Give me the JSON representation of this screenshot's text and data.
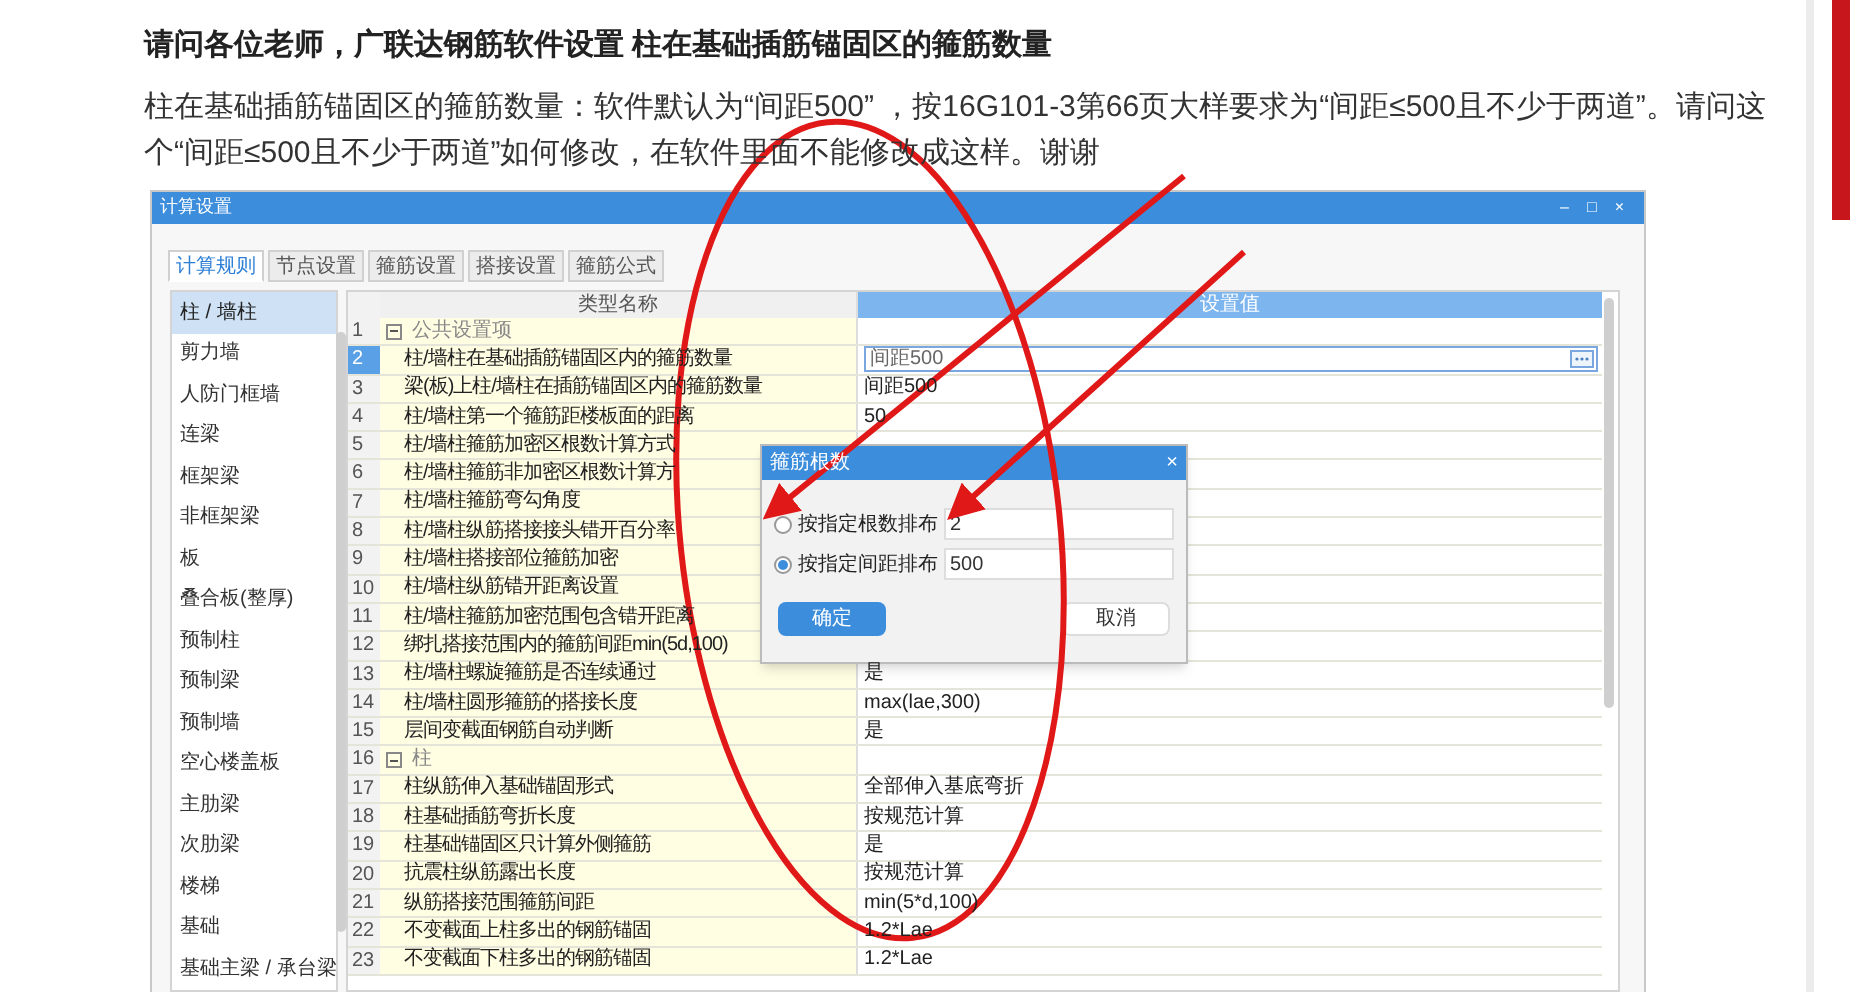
{
  "post": {
    "title": "请问各位老师，广联达钢筋软件设置 柱在基础插筋锚固区的箍筋数量",
    "body": "柱在基础插筋锚固区的箍筋数量：软件默认为“间距500” ，按16G101-3第66页大样要求为“间距≤500且不少于两道”。请问这个“间距≤500且不少于两道”如何修改，在软件里面不能修改成这样。谢谢"
  },
  "window": {
    "title": "计算设置",
    "controls": [
      "–",
      "□",
      "×"
    ]
  },
  "tabs": [
    {
      "label": "计算规则",
      "selected": true
    },
    {
      "label": "节点设置",
      "selected": false
    },
    {
      "label": "箍筋设置",
      "selected": false
    },
    {
      "label": "搭接设置",
      "selected": false
    },
    {
      "label": "箍筋公式",
      "selected": false
    }
  ],
  "sidebar": {
    "items": [
      {
        "label": "柱 / 墙柱",
        "selected": true
      },
      {
        "label": "剪力墙",
        "selected": false
      },
      {
        "label": "人防门框墙",
        "selected": false
      },
      {
        "label": "连梁",
        "selected": false
      },
      {
        "label": "框架梁",
        "selected": false
      },
      {
        "label": "非框架梁",
        "selected": false
      },
      {
        "label": "板",
        "selected": false
      },
      {
        "label": "叠合板(整厚)",
        "selected": false
      },
      {
        "label": "预制柱",
        "selected": false
      },
      {
        "label": "预制梁",
        "selected": false
      },
      {
        "label": "预制墙",
        "selected": false
      },
      {
        "label": "空心楼盖板",
        "selected": false
      },
      {
        "label": "主肋梁",
        "selected": false
      },
      {
        "label": "次肋梁",
        "selected": false
      },
      {
        "label": "楼梯",
        "selected": false
      },
      {
        "label": "基础",
        "selected": false
      },
      {
        "label": "基础主梁 / 承台梁",
        "selected": false
      }
    ]
  },
  "table": {
    "columns": [
      "类型名称",
      "设置值"
    ],
    "rows": [
      {
        "num": "1",
        "kind": "group",
        "expanded": true,
        "name": "公共设置项",
        "selected": false
      },
      {
        "num": "2",
        "kind": "item",
        "name": "柱/墙柱在基础插筋锚固区内的箍筋数量",
        "value": "间距500",
        "selected": true
      },
      {
        "num": "3",
        "kind": "item",
        "name": "梁(板)上柱/墙柱在插筋锚固区内的箍筋数量",
        "value": "间距500",
        "selected": false
      },
      {
        "num": "4",
        "kind": "item",
        "name": "柱/墙柱第一个箍筋距楼板面的距离",
        "value": "50",
        "selected": false
      },
      {
        "num": "5",
        "kind": "item",
        "name": "柱/墙柱箍筋加密区根数计算方式",
        "selected": false
      },
      {
        "num": "6",
        "kind": "item",
        "name": "柱/墙柱箍筋非加密区根数计算方",
        "selected": false
      },
      {
        "num": "7",
        "kind": "item",
        "name": "柱/墙柱箍筋弯勾角度",
        "selected": false
      },
      {
        "num": "8",
        "kind": "item",
        "name": "柱/墙柱纵筋搭接接头错开百分率",
        "selected": false
      },
      {
        "num": "9",
        "kind": "item",
        "name": "柱/墙柱搭接部位箍筋加密",
        "selected": false
      },
      {
        "num": "10",
        "kind": "item",
        "name": "柱/墙柱纵筋错开距离设置",
        "selected": false
      },
      {
        "num": "11",
        "kind": "item",
        "name": "柱/墙柱箍筋加密范围包含错开距离",
        "selected": false
      },
      {
        "num": "12",
        "kind": "item",
        "name": "绑扎搭接范围内的箍筋间距min(5d,100)",
        "selected": false
      },
      {
        "num": "13",
        "kind": "item",
        "name": "柱/墙柱螺旋箍筋是否连续通过",
        "value": "是",
        "selected": false
      },
      {
        "num": "14",
        "kind": "item",
        "name": "柱/墙柱圆形箍筋的搭接长度",
        "value": "max(lae,300)",
        "selected": false
      },
      {
        "num": "15",
        "kind": "item",
        "name": "层间变截面钢筋自动判断",
        "value": "是",
        "selected": false
      },
      {
        "num": "16",
        "kind": "group",
        "expanded": true,
        "name": "柱",
        "selected": false
      },
      {
        "num": "17",
        "kind": "item",
        "name": "柱纵筋伸入基础锚固形式",
        "value": "全部伸入基底弯折",
        "selected": false
      },
      {
        "num": "18",
        "kind": "item",
        "name": "柱基础插筋弯折长度",
        "value": "按规范计算",
        "selected": false
      },
      {
        "num": "19",
        "kind": "item",
        "name": "柱基础锚固区只计算外侧箍筋",
        "value": "是",
        "selected": false
      },
      {
        "num": "20",
        "kind": "item",
        "name": "抗震柱纵筋露出长度",
        "value": "按规范计算",
        "selected": false
      },
      {
        "num": "21",
        "kind": "item",
        "name": "纵筋搭接范围箍筋间距",
        "value": "min(5*d,100)",
        "selected": false
      },
      {
        "num": "22",
        "kind": "item",
        "name": "不变截面上柱多出的钢筋锚固",
        "value": "1.2*Lae",
        "selected": false
      },
      {
        "num": "23",
        "kind": "item",
        "name": "不变截面下柱多出的钢筋锚固",
        "value": "1.2*Lae",
        "selected": false
      }
    ]
  },
  "dialog": {
    "title": "箍筋根数",
    "close": "×",
    "options": [
      {
        "label": "按指定根数排布",
        "value": "2",
        "selected": false
      },
      {
        "label": "按指定间距排布",
        "value": "500",
        "selected": true
      }
    ],
    "buttons": [
      {
        "label": "确定",
        "kind": "primary"
      },
      {
        "label": "取消",
        "kind": "secondary"
      }
    ]
  }
}
